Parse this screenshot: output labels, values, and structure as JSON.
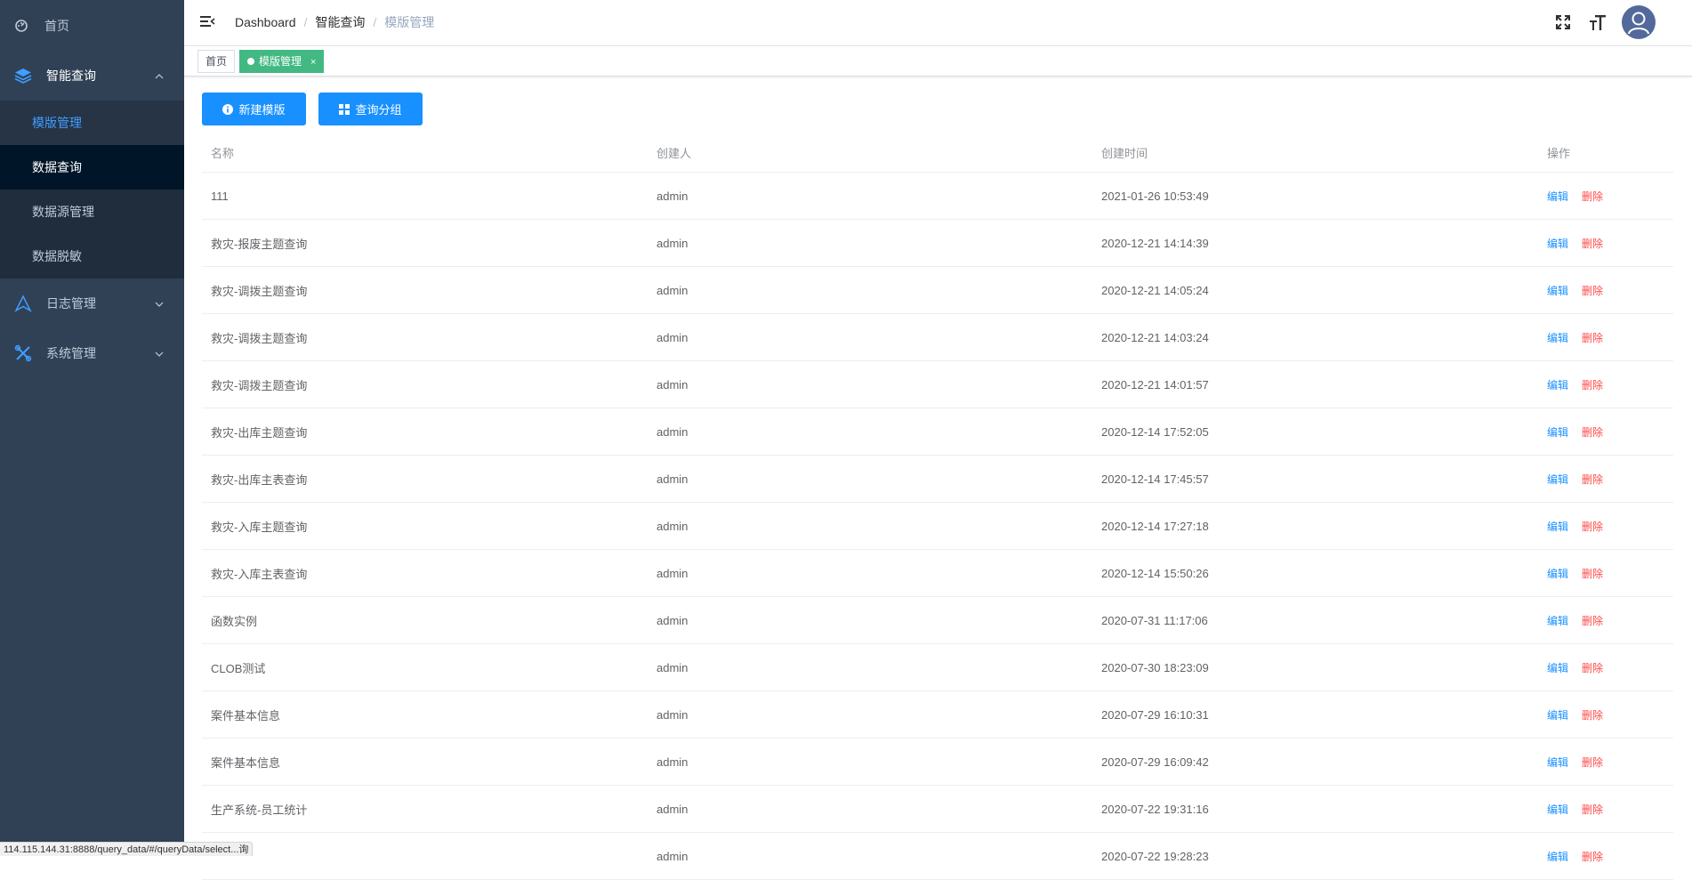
{
  "sidebar": {
    "items": [
      {
        "label": "首页",
        "icon": "dashboard-icon"
      },
      {
        "label": "智能查询",
        "icon": "layers-icon",
        "expanded": true,
        "children": [
          {
            "label": "模版管理",
            "active": true
          },
          {
            "label": "数据查询"
          },
          {
            "label": "数据源管理"
          },
          {
            "label": "数据脱敏"
          }
        ]
      },
      {
        "label": "日志管理",
        "icon": "triangle-icon"
      },
      {
        "label": "系统管理",
        "icon": "tools-icon"
      }
    ]
  },
  "navbar": {
    "breadcrumb": [
      "Dashboard",
      "智能查询",
      "模版管理"
    ],
    "separator": "/"
  },
  "tags": [
    {
      "label": "首页",
      "active": false
    },
    {
      "label": "模版管理",
      "active": true,
      "close": "×"
    }
  ],
  "toolbar": {
    "new_template": "新建模版",
    "query_group": "查询分组"
  },
  "table": {
    "headers": [
      "名称",
      "创建人",
      "创建时间",
      "操作"
    ],
    "edit_label": "编辑",
    "delete_label": "删除",
    "rows": [
      {
        "name": "111",
        "creator": "admin",
        "created": "2021-01-26 10:53:49"
      },
      {
        "name": "救灾-报废主题查询",
        "creator": "admin",
        "created": "2020-12-21 14:14:39"
      },
      {
        "name": "救灾-调拨主题查询",
        "creator": "admin",
        "created": "2020-12-21 14:05:24"
      },
      {
        "name": "救灾-调拨主题查询",
        "creator": "admin",
        "created": "2020-12-21 14:03:24"
      },
      {
        "name": "救灾-调拨主题查询",
        "creator": "admin",
        "created": "2020-12-21 14:01:57"
      },
      {
        "name": "救灾-出库主题查询",
        "creator": "admin",
        "created": "2020-12-14 17:52:05"
      },
      {
        "name": "救灾-出库主表查询",
        "creator": "admin",
        "created": "2020-12-14 17:45:57"
      },
      {
        "name": "救灾-入库主题查询",
        "creator": "admin",
        "created": "2020-12-14 17:27:18"
      },
      {
        "name": "救灾-入库主表查询",
        "creator": "admin",
        "created": "2020-12-14 15:50:26"
      },
      {
        "name": "函数实例",
        "creator": "admin",
        "created": "2020-07-31 11:17:06"
      },
      {
        "name": "CLOB测试",
        "creator": "admin",
        "created": "2020-07-30 18:23:09"
      },
      {
        "name": "案件基本信息",
        "creator": "admin",
        "created": "2020-07-29 16:10:31"
      },
      {
        "name": "案件基本信息",
        "creator": "admin",
        "created": "2020-07-29 16:09:42"
      },
      {
        "name": "生产系统-员工统计",
        "creator": "admin",
        "created": "2020-07-22 19:31:16"
      },
      {
        "name": "",
        "creator": "admin",
        "created": "2020-07-22 19:28:23"
      }
    ]
  },
  "statusbar": {
    "url": "114.115.144.31:8888/query_data/#/queryData/select...询"
  },
  "colors": {
    "sidebar_bg": "#304156",
    "accent": "#1890ff",
    "tag_active": "#42b983",
    "danger": "#ff4949"
  }
}
